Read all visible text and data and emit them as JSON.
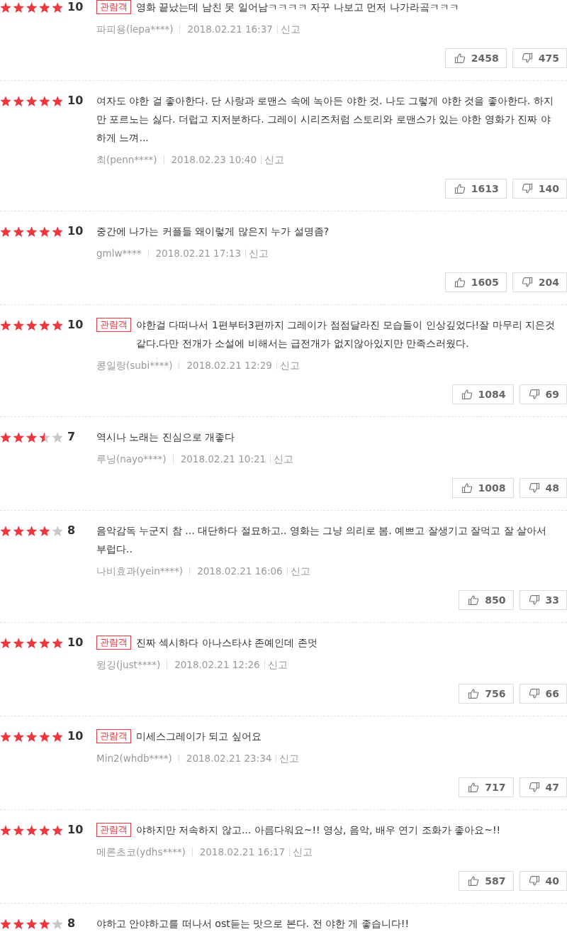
{
  "reviews": [
    {
      "stars": 5,
      "score": "10",
      "badge": "관람객",
      "text": "영화 끝났는데 남친 못 일어남ㅋㅋㅋㅋ 자꾸 나보고 먼저 나가라곸ㅋㅋㅋ",
      "author": "파피용(lepa****)",
      "date": "2018.02.21 16:37",
      "report": "신고",
      "likes": "2458",
      "dislikes": "475"
    },
    {
      "stars": 5,
      "score": "10",
      "text": "여자도 야한 걸 좋아한다. 단 사랑과 로맨스 속에 녹아든 야한 것. 나도 그렇게 야한 것을 좋아한다. 하지만 포르노는 싫다. 더럽고 지저분하다. 그레이 시리즈처럼 스토리와 로맨스가 있는 야한 영화가 진짜 야하게 느껴...",
      "author": "최(penn****)",
      "date": "2018.02.23 10:40",
      "report": "신고",
      "likes": "1613",
      "dislikes": "140"
    },
    {
      "stars": 5,
      "score": "10",
      "text": "중간에 나가는 커플들 왜이렇게 많은지 누가 설명좀?",
      "author": "gmlw****",
      "date": "2018.02.21 17:13",
      "report": "신고",
      "likes": "1605",
      "dislikes": "204"
    },
    {
      "stars": 5,
      "score": "10",
      "badge": "관람객",
      "text": "야한걸 다떠나서 1편부터3편까지 그레이가 점점달라진 모습들이 인상깊었다!잘 마무리 지은것같다.다만 전개가 소설에 비해서는 급전개가 없지않아있지만 만족스러웠다.",
      "author": "콩일랑(subi****)",
      "date": "2018.02.21 12:29",
      "report": "신고",
      "likes": "1084",
      "dislikes": "69"
    },
    {
      "stars": 3.5,
      "score": "7",
      "text": "역시나 노래는 진심으로 개좋다",
      "author": "루닝(nayo****)",
      "date": "2018.02.21 10:21",
      "report": "신고",
      "likes": "1008",
      "dislikes": "48"
    },
    {
      "stars": 4,
      "score": "8",
      "text": "음악감독 누군지 참 ... 대단하다 절묘하고.. 영화는 그냥 의리로 봄. 예쁘고 잘생기고 잘먹고 잘 살아서 부럽다..",
      "author": "나비효과(yein****)",
      "date": "2018.02.21 16:06",
      "report": "신고",
      "likes": "850",
      "dislikes": "33"
    },
    {
      "stars": 5,
      "score": "10",
      "badge": "관람객",
      "text": "진짜 섹시하다 아나스타샤 존예인데 존멋",
      "author": "윙깅(just****)",
      "date": "2018.02.21 12:26",
      "report": "신고",
      "likes": "756",
      "dislikes": "66"
    },
    {
      "stars": 5,
      "score": "10",
      "badge": "관람객",
      "text": "미세스그레이가 되고 싶어요",
      "author": "Min2(whdb****)",
      "date": "2018.02.21 23:34",
      "report": "신고",
      "likes": "717",
      "dislikes": "47"
    },
    {
      "stars": 5,
      "score": "10",
      "badge": "관람객",
      "text": "야하지만 저속하지 않고... 아름다워요~!! 영상, 음악, 배우 연기 조화가 좋아요~!!",
      "author": "메론초코(ydhs****)",
      "date": "2018.02.21 16:17",
      "report": "신고",
      "likes": "587",
      "dislikes": "40"
    },
    {
      "stars": 4,
      "score": "8",
      "text": "야하고 안야하고를 떠나서 ost듣는 맛으로 본다. 전 야한 게 좋습니다!!"
    }
  ]
}
